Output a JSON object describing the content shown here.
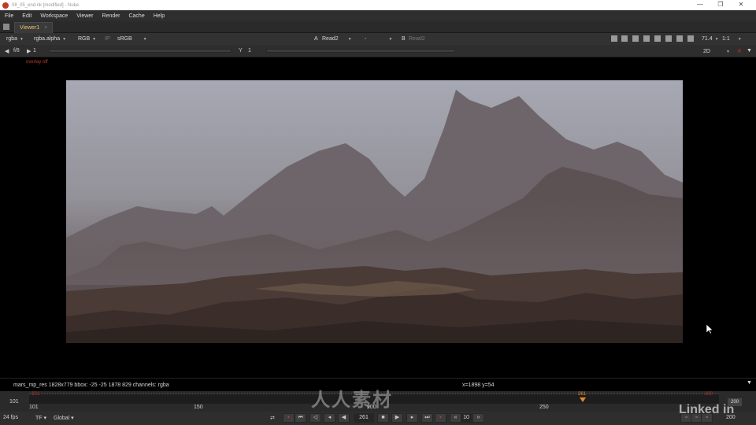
{
  "window": {
    "title": "08_05_end.nk [modified] - Nuke",
    "controls": [
      "—",
      "❐",
      "✕"
    ]
  },
  "menu": [
    "File",
    "Edit",
    "Workspace",
    "Viewer",
    "Render",
    "Cache",
    "Help"
  ],
  "tab": {
    "label": "Viewer1",
    "close": "×"
  },
  "viewer_controls": {
    "channels": "rgba",
    "alpha": "rgba.alpha",
    "display": "RGB",
    "ip": "IP",
    "lut": "sRGB",
    "input_a_label": "A",
    "input_a": "Read2",
    "wipe": "-",
    "input_b_label": "B",
    "input_b": "Read2",
    "zoom": "71.4",
    "ratio": "1:1",
    "fstop": "f/8",
    "gain": "1",
    "y_label": "Y",
    "gamma": "1",
    "view_mode": "2D"
  },
  "overlay_label": "overlay off",
  "info": {
    "node": "mars_mp_res 1828x779  bbox: -25 -25 1878 829 channels: rgba",
    "coords": "x=1898 y=54"
  },
  "timeline": {
    "start_frame": "101",
    "labels": [
      "101",
      "150",
      "200",
      "250"
    ],
    "current_frame": "261",
    "range_start": "101",
    "range_end": "300",
    "out_frame": "200",
    "current_position": 0.8
  },
  "playback": {
    "fps": "24 fps",
    "tf": "TF",
    "scope": "Global",
    "frame": "261",
    "increment": "10",
    "end": "200"
  },
  "watermarks": {
    "cn": "人人素材",
    "brand": "Linked in"
  }
}
